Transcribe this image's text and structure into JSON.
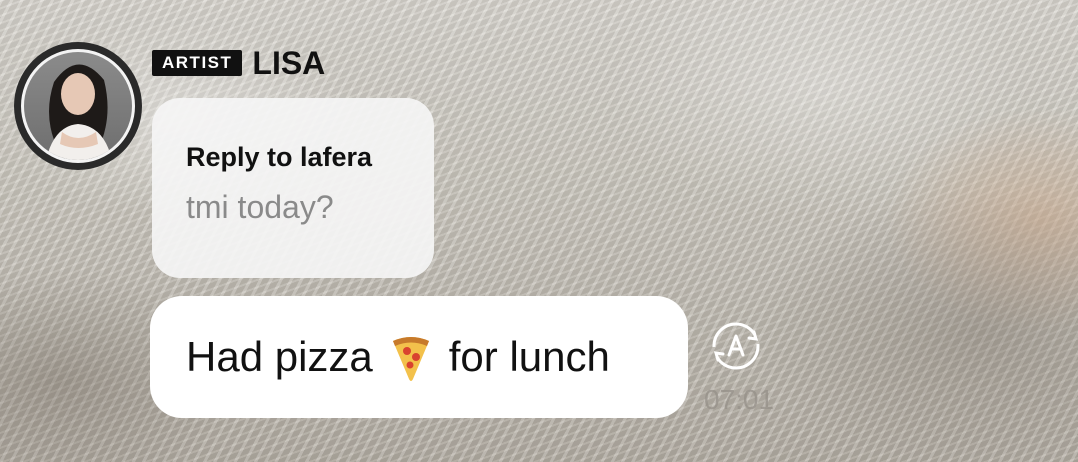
{
  "sender": {
    "badge": "ARTIST",
    "name": "LISA"
  },
  "reply": {
    "title": "Reply to lafera",
    "text": "tmi today?"
  },
  "message": {
    "before_emoji": "Had pizza",
    "emoji": "pizza-emoji",
    "after_emoji": "for lunch",
    "time": "07:01"
  },
  "icons": {
    "translate": "translate-icon",
    "avatar": "avatar"
  }
}
